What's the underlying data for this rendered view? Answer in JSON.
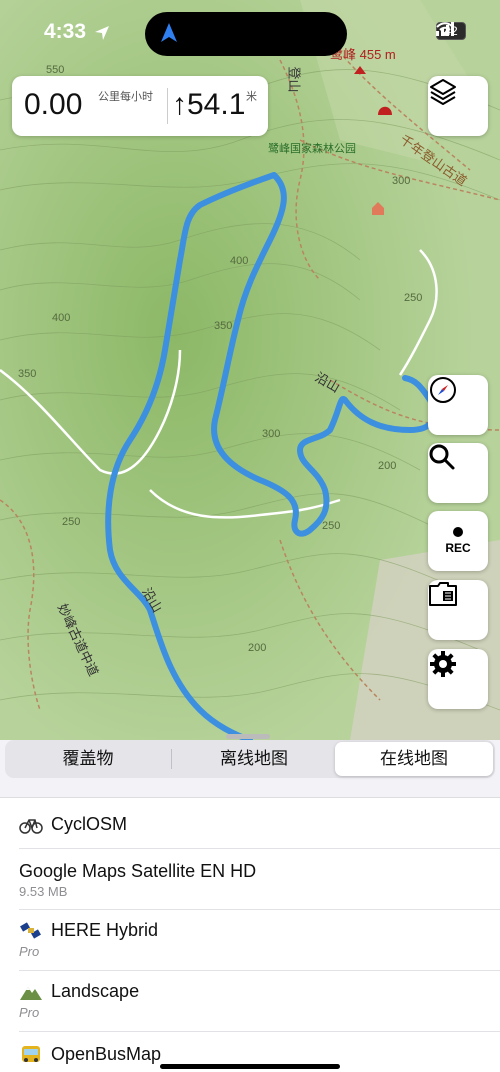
{
  "status_bar": {
    "time": "4:33",
    "battery": "42"
  },
  "speed_panel": {
    "speed": "0.00",
    "speed_unit": "公里每小时",
    "climb": "↑54.1",
    "climb_unit": "米"
  },
  "map_labels": {
    "peak": "鹭峰 455 m",
    "park": "鹭峰国家森林公园",
    "ancient_trail": "千年登山古道",
    "road_left": "妙峰古道中道",
    "trail_a": "沿山",
    "trail_b": "沿山",
    "mountain_road": "登山",
    "contours": [
      "550",
      "400",
      "350",
      "400",
      "350",
      "300",
      "250",
      "300",
      "200",
      "250",
      "250",
      "200",
      "250",
      "200",
      "300"
    ]
  },
  "map_buttons": [
    "layers",
    "compass",
    "search",
    "rec",
    "offline-maps",
    "settings"
  ],
  "rec_label": "REC",
  "segments": {
    "items": [
      "覆盖物",
      "离线地图",
      "在线地图"
    ],
    "selected": "在线地图"
  },
  "map_list": [
    {
      "title": "CyclOSM",
      "sub": "",
      "icon": "bicycle-icon"
    },
    {
      "title": "Google Maps Satellite EN HD",
      "sub": "9.53 MB",
      "icon": ""
    },
    {
      "title": "HERE Hybrid",
      "sub": "Pro",
      "icon": "satellite-icon"
    },
    {
      "title": "Landscape",
      "sub": "Pro",
      "icon": "mountain-icon"
    },
    {
      "title": "OpenBusMap",
      "sub": "",
      "icon": "bus-icon"
    }
  ],
  "colors": {
    "track": "#3d8fe0",
    "map_green": "#a9c98a",
    "active_segment": "#ffffff"
  }
}
